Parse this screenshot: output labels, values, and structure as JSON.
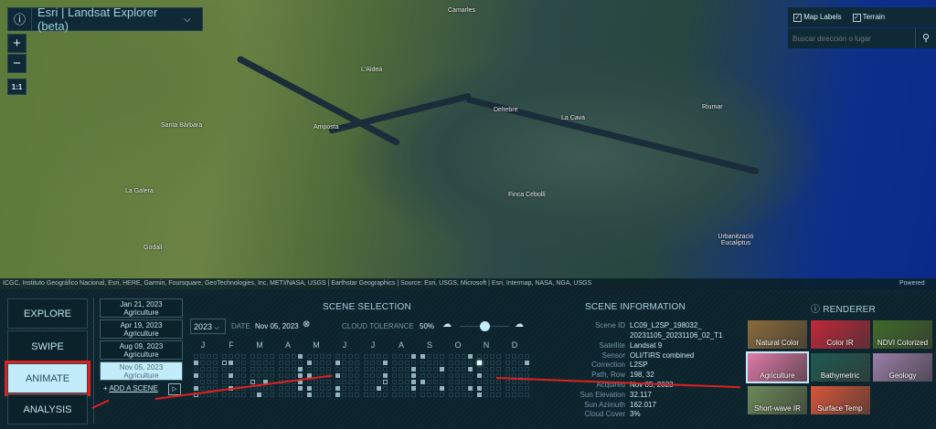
{
  "app": {
    "title": "Esri | Landsat Explorer (beta)",
    "info_icon": "info-icon",
    "chevron_icon": "chevron-down-icon"
  },
  "map_controls": {
    "zoom_in": "+",
    "zoom_out": "−",
    "scale": "1:1"
  },
  "map_options": {
    "map_labels": "Map Labels",
    "terrain": "Terrain",
    "map_labels_checked": true,
    "terrain_checked": true
  },
  "search": {
    "placeholder": "Buscar dirección o lugar",
    "icon": "search-icon"
  },
  "map_labels": [
    "Camarles",
    "L'Aldea",
    "Amposta",
    "Deltebre",
    "La Cava",
    "Riumar",
    "Santa Bàrbara",
    "La Galera",
    "Godall",
    "Finca Cebollí",
    "Urbanització Eucaliptus"
  ],
  "attribution": "ICGC, Instituto Geográfico Nacional, Esri, HERE, Garmin, Foursquare, GeoTechnologies, Inc, METI/NASA, USGS | Earthstar Geographics | Source: Esri, USGS, Microsoft | Esri, Intermap, NASA, NGA, USGS",
  "powered_by": "Powered by",
  "nav": [
    {
      "label": "EXPLORE"
    },
    {
      "label": "SWIPE"
    },
    {
      "label": "ANIMATE",
      "active": true
    },
    {
      "label": "ANALYSIS"
    }
  ],
  "animation_scenes": [
    {
      "date": "Jan 21, 2023",
      "renderer": "Agriculture"
    },
    {
      "date": "Apr 19, 2023",
      "renderer": "Agriculture"
    },
    {
      "date": "Aug 09, 2023",
      "renderer": "Agriculture"
    },
    {
      "date": "Nov 05, 2023",
      "renderer": "Agriculture",
      "selected": true
    }
  ],
  "add_scene": "ADD A SCENE",
  "scene_selection": {
    "title": "SCENE SELECTION",
    "year": "2023",
    "date_label": "DATE",
    "date_value": "Nov 05, 2023",
    "cloud_label": "CLOUD TOLERANCE",
    "cloud_value": "50%",
    "cloud_tolerance": 0.5,
    "months": [
      "J",
      "F",
      "M",
      "A",
      "M",
      "J",
      "J",
      "A",
      "S",
      "O",
      "N",
      "D"
    ],
    "available": [
      [
        4,
        12,
        20
      ],
      [
        5,
        13,
        21
      ],
      [
        18,
        25
      ],
      [
        3,
        11,
        15,
        19,
        23
      ],
      [
        4,
        12,
        20,
        24
      ],
      [
        4,
        12,
        20,
        24
      ],
      [
        7,
        15,
        22
      ],
      [
        3,
        11,
        15,
        19,
        23
      ],
      [
        0,
        11,
        16,
        23
      ],
      [
        3,
        11,
        23
      ],
      [
        4,
        12,
        20,
        24
      ],
      [
        7
      ]
    ],
    "cloudy": [
      [
        12,
        24
      ],
      [
        4
      ],
      [
        16
      ],
      [],
      [
        12,
        24
      ],
      [
        24
      ],
      [
        19
      ],
      [],
      [
        0,
        16
      ],
      [],
      [],
      []
    ],
    "selected": {
      "month": 10,
      "cell": 4
    }
  },
  "scene_info": {
    "title": "SCENE INFORMATION",
    "rows": [
      {
        "label": "Scene ID",
        "value": "LC09_L2SP_198032_",
        "value2": "20231105_20231106_02_T1"
      },
      {
        "label": "Satellite",
        "value": "Landsat 9"
      },
      {
        "label": "Sensor",
        "value": "OLI/TIRS combined"
      },
      {
        "label": "Correction",
        "value": "L2SP"
      },
      {
        "label": "Path, Row",
        "value": "198, 32"
      },
      {
        "label": "Acquired",
        "value": "Nov 05, 2023"
      },
      {
        "label": "Sun Elevation",
        "value": "32.117"
      },
      {
        "label": "Sun Azimuth",
        "value": "162.017"
      },
      {
        "label": "Cloud Cover",
        "value": "3%"
      }
    ]
  },
  "renderer": {
    "title": "RENDERER",
    "items": [
      {
        "label": "Natural Color",
        "color": "#8a6a3a"
      },
      {
        "label": "Color IR",
        "color": "#c0283a"
      },
      {
        "label": "NDVI Colorized",
        "color": "#3f6a2a"
      },
      {
        "label": "Agriculture",
        "color": "#e07aa8",
        "selected": true
      },
      {
        "label": "Bathymetric",
        "color": "#1f5a52"
      },
      {
        "label": "Geology",
        "color": "#9a7fa8"
      },
      {
        "label": "Short-wave IR",
        "color": "#6c8a5a"
      },
      {
        "label": "Surface Temp",
        "color": "#d8563a"
      }
    ]
  }
}
